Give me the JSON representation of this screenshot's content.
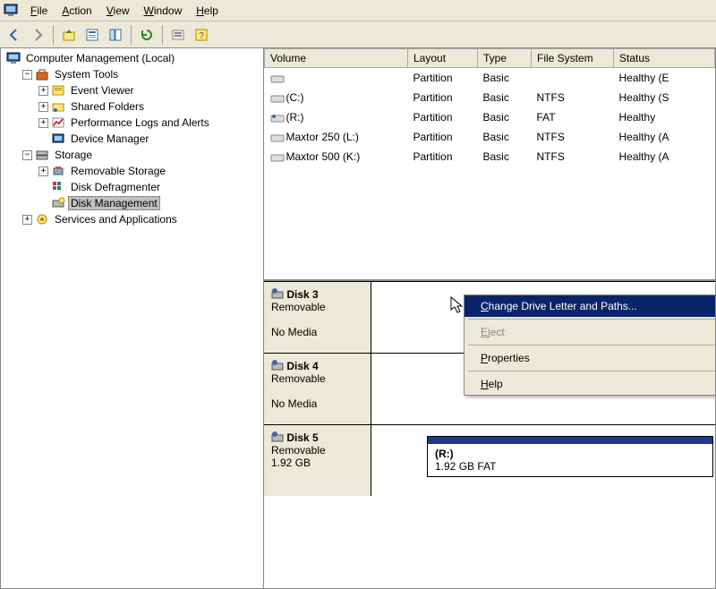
{
  "menu": {
    "file": "File",
    "action": "Action",
    "view": "View",
    "window": "Window",
    "help": "Help"
  },
  "tree": {
    "root": "Computer Management (Local)",
    "systools": "System Tools",
    "event": "Event Viewer",
    "shared": "Shared Folders",
    "perf": "Performance Logs and Alerts",
    "devmgr": "Device Manager",
    "storage": "Storage",
    "remov": "Removable Storage",
    "defrag": "Disk Defragmenter",
    "diskmgmt": "Disk Management",
    "services": "Services and Applications"
  },
  "columns": {
    "volume": "Volume",
    "layout": "Layout",
    "type": "Type",
    "fs": "File System",
    "status": "Status"
  },
  "volumes": [
    {
      "name": "",
      "layout": "Partition",
      "type": "Basic",
      "fs": "",
      "status": "Healthy (E"
    },
    {
      "name": "(C:)",
      "layout": "Partition",
      "type": "Basic",
      "fs": "NTFS",
      "status": "Healthy (S"
    },
    {
      "name": "(R:)",
      "layout": "Partition",
      "type": "Basic",
      "fs": "FAT",
      "status": "Healthy"
    },
    {
      "name": "Maxtor 250 (L:)",
      "layout": "Partition",
      "type": "Basic",
      "fs": "NTFS",
      "status": "Healthy (A"
    },
    {
      "name": "Maxtor 500 (K:)",
      "layout": "Partition",
      "type": "Basic",
      "fs": "NTFS",
      "status": "Healthy (A"
    }
  ],
  "disks": {
    "d3": {
      "title": "Disk 3",
      "sub": "Removable",
      "status": "No Media"
    },
    "d4": {
      "title": "Disk 4",
      "sub": "Removable",
      "status": "No Media"
    },
    "d5": {
      "title": "Disk 5",
      "sub": "Removable",
      "size": "1.92 GB",
      "part_label": "(R:)",
      "part_sub": "1.92 GB FAT"
    }
  },
  "cm": {
    "change": "Change Drive Letter and Paths...",
    "eject": "Eject",
    "props": "Properties",
    "help": "Help"
  }
}
